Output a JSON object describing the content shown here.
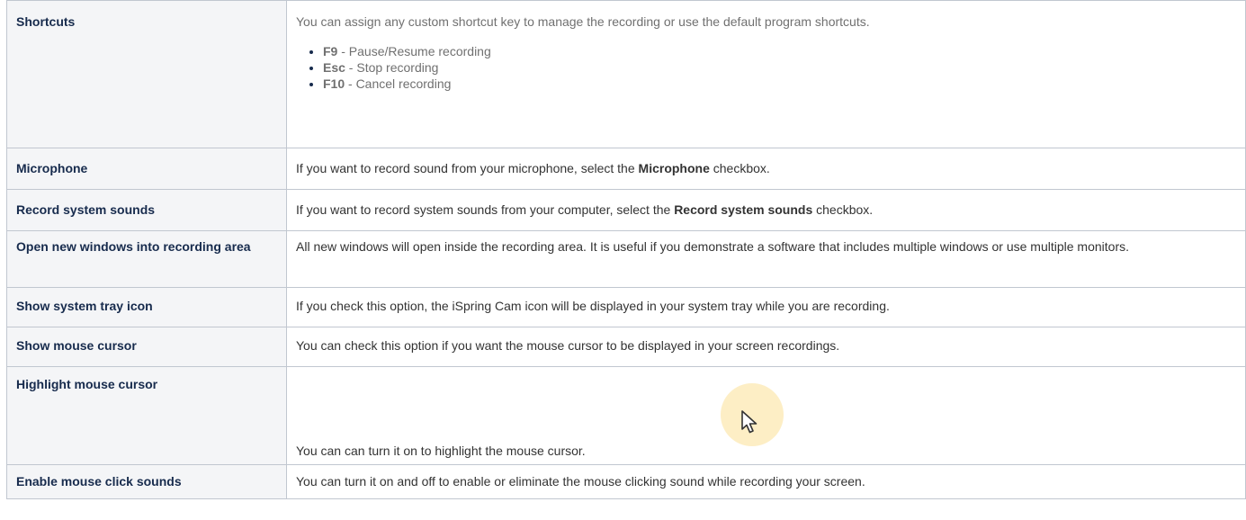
{
  "rows": [
    {
      "label": "Shortcuts",
      "intro": "You can assign any custom shortcut key to manage the recording or use the default program shortcuts.",
      "items": [
        {
          "key": "F9",
          "text": " - Pause/Resume recording"
        },
        {
          "key": "Esc",
          "text": " - Stop recording"
        },
        {
          "key": "F10",
          "text": " - Cancel recording"
        }
      ]
    },
    {
      "label": "Microphone",
      "pre": "If you want to record sound from your microphone, select the ",
      "bold": "Microphone",
      "post": " checkbox."
    },
    {
      "label": "Record system sounds",
      "pre": "If you want to record system sounds from your computer, select the ",
      "bold": "Record system sounds",
      "post": " checkbox."
    },
    {
      "label": "Open new windows into recording area",
      "text": "All new windows will open inside the recording area. It is useful if you demonstrate a software that includes multiple windows or use multiple monitors."
    },
    {
      "label": "Show system tray icon",
      "text": "If you check this option, the iSpring Cam icon will be displayed in your system tray while you are recording."
    },
    {
      "label": "Show mouse cursor",
      "text": "You can check this option if you want the mouse cursor to be displayed in your screen recordings."
    },
    {
      "label": "Highlight mouse cursor",
      "text": "You can can turn it on to highlight the mouse cursor.",
      "visual": {
        "icon": "highlighted-cursor-icon",
        "highlight_color": "#fdeec5"
      }
    },
    {
      "label": "Enable mouse click sounds",
      "text": "You can turn it on and off to enable or eliminate the mouse clicking sound while recording your screen."
    }
  ]
}
